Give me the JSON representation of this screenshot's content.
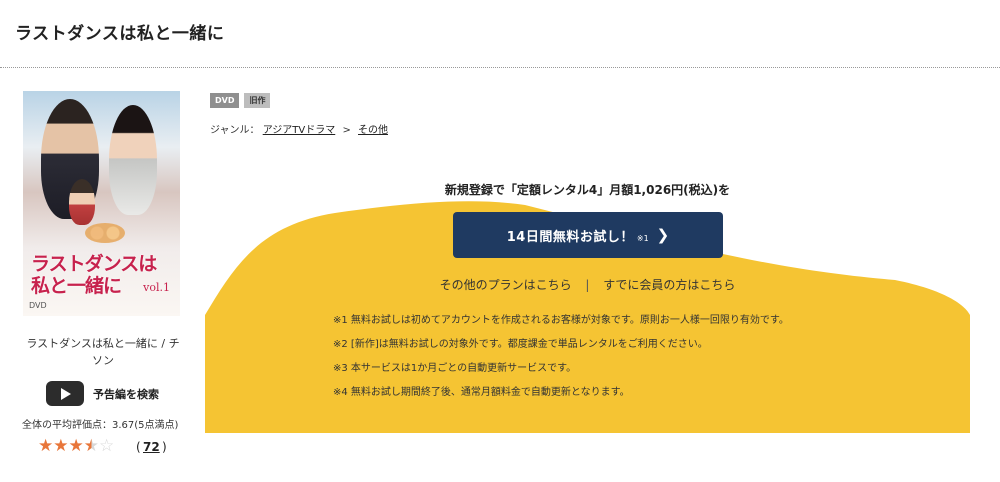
{
  "page": {
    "title": "ラストダンスは私と一緒に"
  },
  "poster": {
    "title_line1": "ラストダンスは",
    "title_line2": "私と一緒に",
    "vol": "vol.1",
    "dvd_mark": "DVD"
  },
  "item": {
    "name": "ラストダンスは私と一緒に / チソン",
    "trailer_label": "予告編を検索",
    "rating_label": "全体の平均評価点：3.67(5点満点)",
    "rating_value": 3.67,
    "rating_max": 5,
    "review_count": "72"
  },
  "badges": {
    "format": "DVD",
    "age": "旧作"
  },
  "genre": {
    "label": "ジャンル：",
    "level1": "アジアTVドラマ",
    "separator": ">",
    "level2": "その他"
  },
  "promo": {
    "headline": "新規登録で「定額レンタル4」月額1,026円(税込)を",
    "cta_label": "14日間無料お試し！",
    "cta_note": "※1",
    "cta_chevron": "❯",
    "other_plans": "その他のプランはこちら",
    "divider": "|",
    "member_link": "すでに会員の方はこちら",
    "bg_color": "#f5c433",
    "button_color": "#1f3a61"
  },
  "notes": [
    "※1 無料お試しは初めてアカウントを作成されるお客様が対象です。原則お一人様一回限り有効です。",
    "※2 [新作]は無料お試しの対象外です。都度課金で単品レンタルをご利用ください。",
    "※3 本サービスは1か月ごとの自動更新サービスです。",
    "※4 無料お試し期間終了後、通常月額料金で自動更新となります。"
  ]
}
